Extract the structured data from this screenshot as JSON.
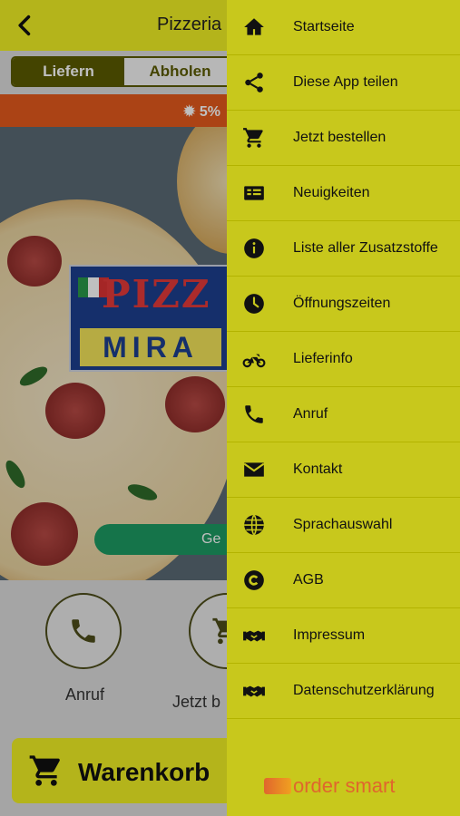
{
  "app": {
    "title": "Pizzeria M",
    "order_mode": {
      "selected": "Liefern",
      "other": "Abholen"
    },
    "promo_text": "5%",
    "hero_logo": {
      "line1": "PIZZ",
      "line2": "MIRA"
    },
    "geo_button": "Ge",
    "actions": [
      {
        "label": "Anruf",
        "icon": "phone-icon"
      },
      {
        "label": "Jetzt b",
        "icon": "cart-icon"
      }
    ],
    "cart_button": "Warenkorb"
  },
  "drawer": {
    "items": [
      {
        "label": "Startseite",
        "icon": "home-icon"
      },
      {
        "label": "Diese App teilen",
        "icon": "share-icon"
      },
      {
        "label": "Jetzt bestellen",
        "icon": "cart-icon"
      },
      {
        "label": "Neuigkeiten",
        "icon": "news-icon"
      },
      {
        "label": "Liste aller Zusatzstoffe",
        "icon": "info-icon"
      },
      {
        "label": "Öffnungszeiten",
        "icon": "clock-icon"
      },
      {
        "label": "Lieferinfo",
        "icon": "motorbike-icon"
      },
      {
        "label": "Anruf",
        "icon": "phone-icon"
      },
      {
        "label": "Kontakt",
        "icon": "envelope-icon"
      },
      {
        "label": "Sprachauswahl",
        "icon": "globe-icon"
      },
      {
        "label": "AGB",
        "icon": "copyright-icon"
      },
      {
        "label": "Impressum",
        "icon": "handshake-icon"
      },
      {
        "label": "Datenschutzerklärung",
        "icon": "handshake-icon"
      }
    ],
    "brand": "order smart"
  },
  "colors": {
    "topbar": "#f1f024",
    "drawer": "#c8c81c",
    "promo": "#e45a1c",
    "brand": "#e0662d"
  }
}
